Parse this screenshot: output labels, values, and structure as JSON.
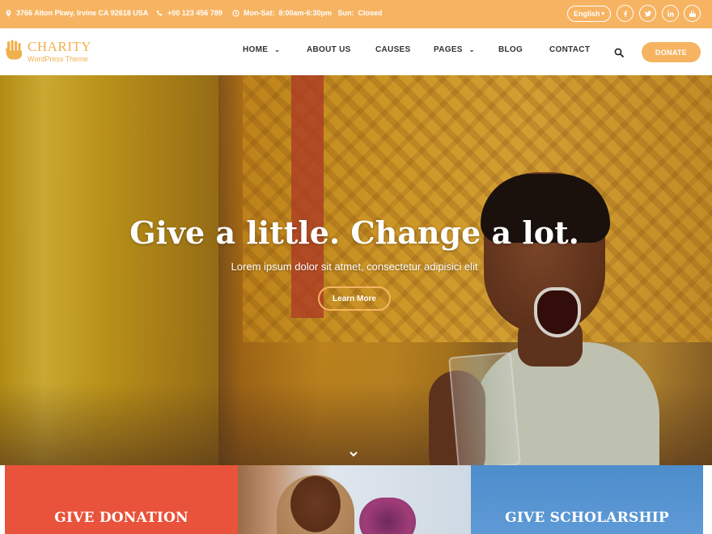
{
  "topbar": {
    "address": "3766 Alton Pkwy, Irvine CA 92618 USA",
    "phone": "+00 123 456 789",
    "hours": "Mon-Sat:  8:00am-6:30pm   Sun:  Closed",
    "language": "English",
    "social_icons": [
      "facebook-icon",
      "twitter-icon",
      "linkedin-icon",
      "youtube-icon"
    ]
  },
  "logo": {
    "title": "CHARITY",
    "subtitle": "WordPress Theme"
  },
  "nav": {
    "items": [
      {
        "label": "HOME",
        "has_dropdown": true
      },
      {
        "label": "ABOUT US",
        "has_dropdown": false
      },
      {
        "label": "CAUSES",
        "has_dropdown": false
      },
      {
        "label": "PAGES",
        "has_dropdown": true
      },
      {
        "label": "BLOG",
        "has_dropdown": false
      },
      {
        "label": "CONTACT",
        "has_dropdown": false
      }
    ],
    "donate_label": "DONATE"
  },
  "hero": {
    "title": "Give a little. Change a lot.",
    "subtitle": "Lorem ipsum dolor sit atmet, consectetur adipisici elit",
    "button_label": "Learn More"
  },
  "cards": [
    {
      "title": "GIVE DONATION"
    },
    {
      "title": ""
    },
    {
      "title": "GIVE SCHOLARSHIP"
    }
  ],
  "colors": {
    "accent": "#f6b462",
    "card_donation": "#e9533b",
    "card_scholarship": "#4d8dcc"
  }
}
